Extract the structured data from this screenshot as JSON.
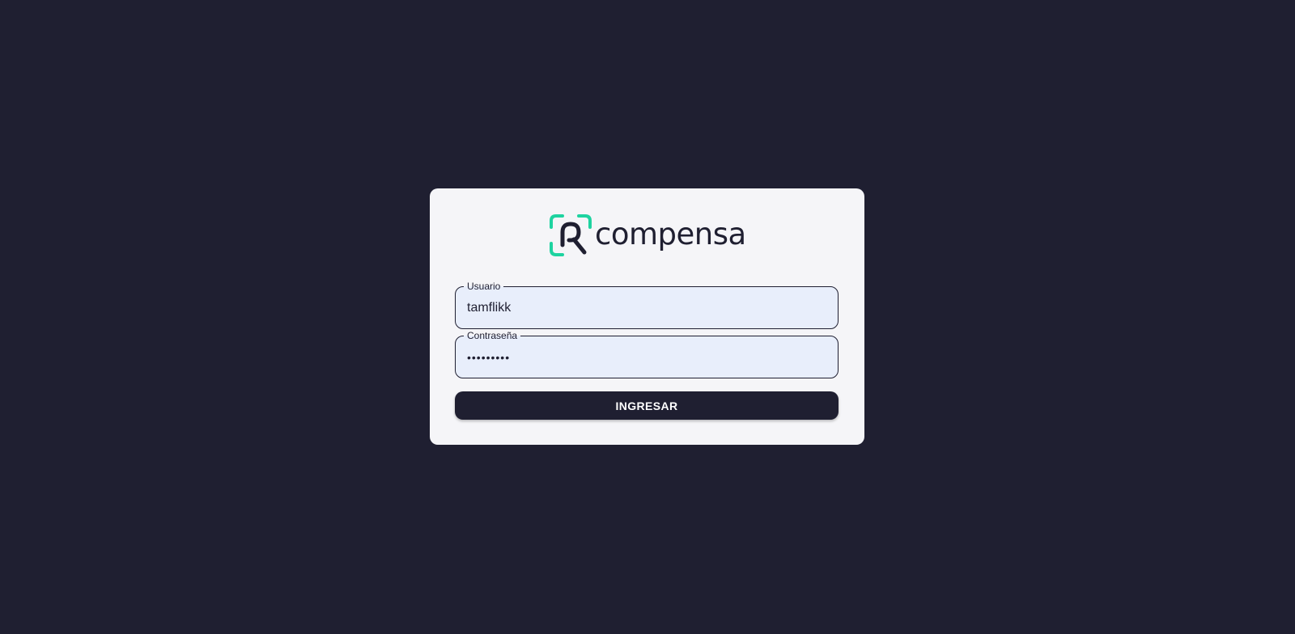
{
  "brand": {
    "logo_text": "compensa",
    "accent_color": "#1ed3a0",
    "dark_color": "#1f1f31"
  },
  "login": {
    "username_label": "Usuario",
    "username_value": "tamflikk",
    "password_label": "Contraseña",
    "password_value": "•••••••••",
    "submit_label": "INGRESAR"
  },
  "colors": {
    "background": "#1f1f31",
    "card": "#f5f5f8",
    "input_fill": "#e8eefb"
  }
}
